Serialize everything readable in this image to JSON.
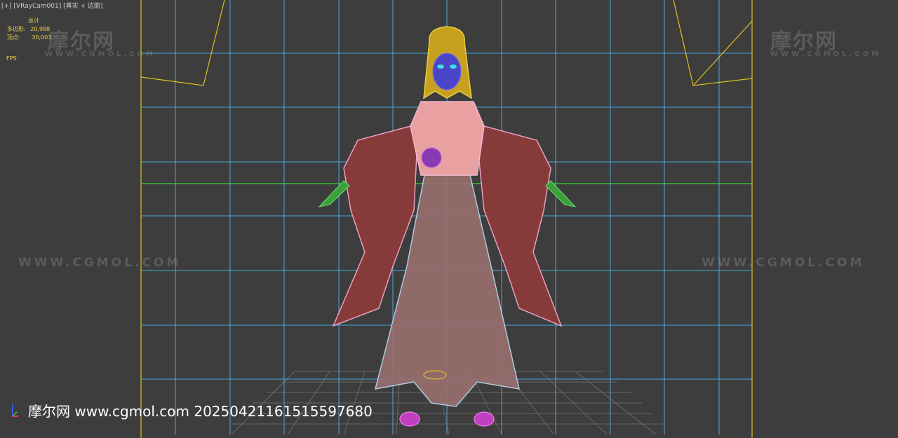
{
  "viewport": {
    "label": "[+] [VRayCam001] [真实 + 边面]",
    "stats": {
      "header": "总计",
      "polys_label": "多边形:",
      "polys_value": "20,988",
      "verts_label": "顶点:",
      "verts_value": "30,003",
      "fps_label": "FPS:"
    }
  },
  "watermarks": {
    "brand": "摩尔网",
    "domain": "WWW.CGMOL.COM"
  },
  "caption": "摩尔网 www.cgmol.com 20250421161515597680",
  "colors": {
    "background": "#3d3d3d",
    "grid": "#4aa8e0",
    "frame": "#e0c020",
    "horizon": "#3ccf3c"
  },
  "icons": [
    "axis-gizmo-icon"
  ]
}
